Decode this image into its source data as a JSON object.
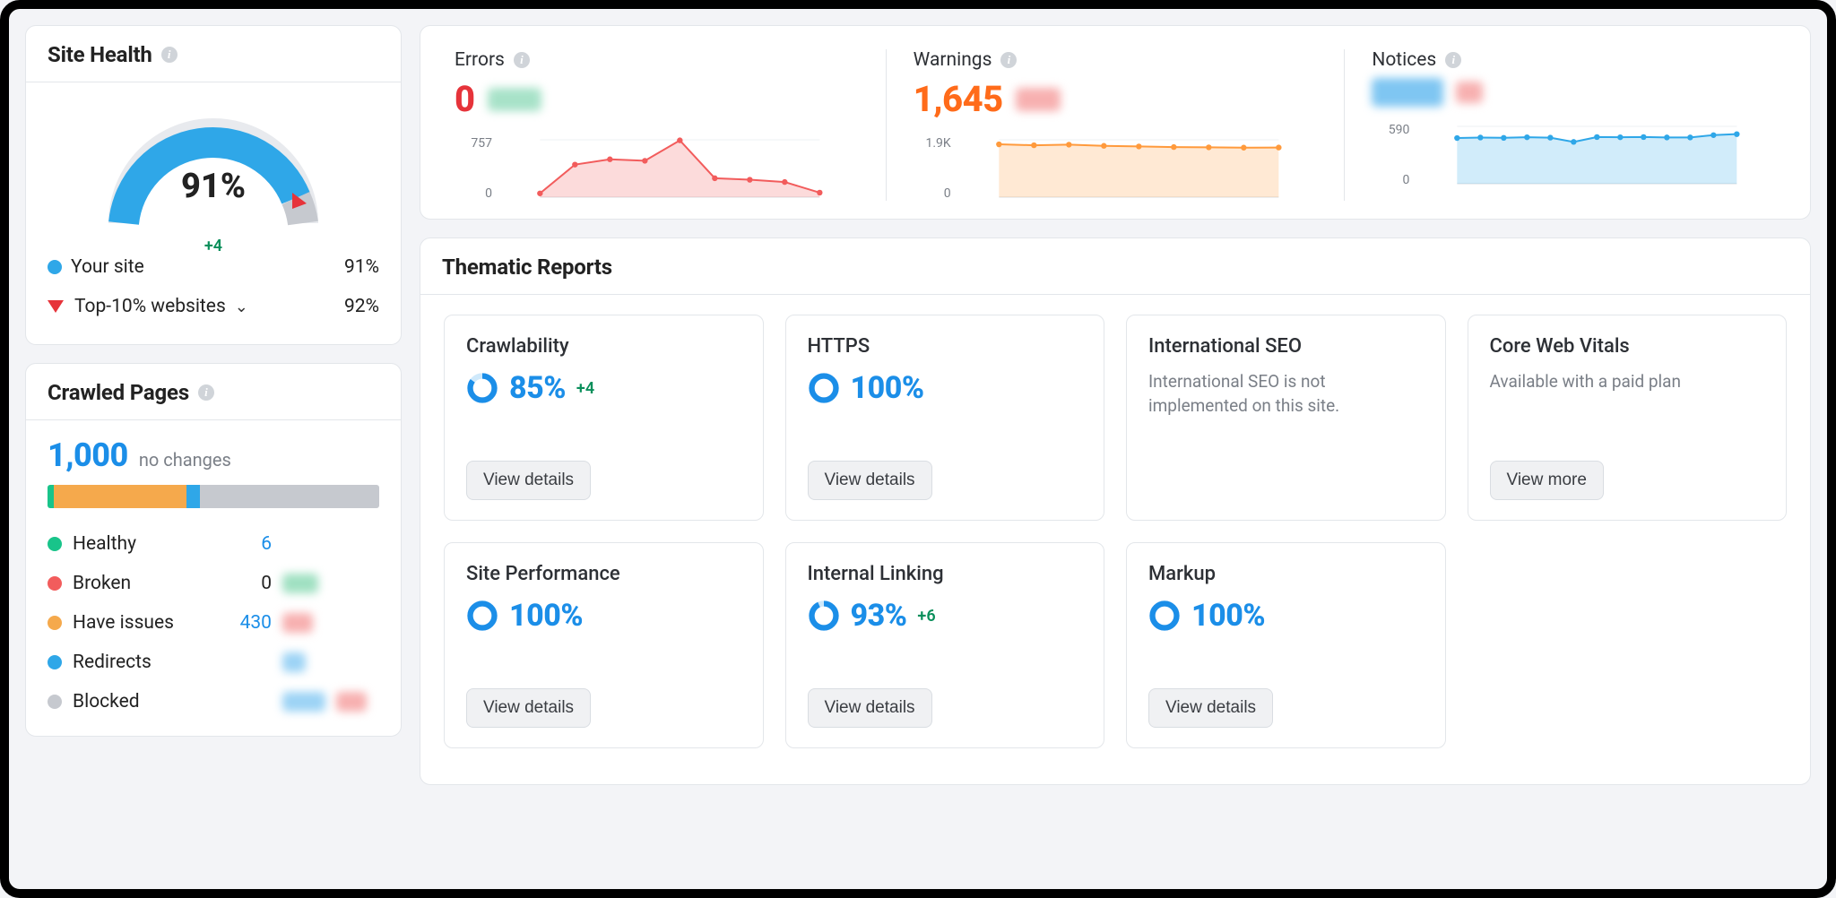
{
  "siteHealth": {
    "title": "Site Health",
    "value": "91%",
    "delta": "+4",
    "legend": {
      "yourSite": {
        "label": "Your site",
        "value": "91%"
      },
      "top10": {
        "label": "Top-10% websites",
        "value": "92%"
      }
    }
  },
  "crawledPages": {
    "title": "Crawled Pages",
    "count": "1,000",
    "changeNote": "no changes",
    "segments": {
      "green": 2,
      "orange": 40,
      "blue": 4,
      "gray": 54
    },
    "rows": {
      "healthy": {
        "label": "Healthy",
        "count": "6"
      },
      "broken": {
        "label": "Broken",
        "count": "0"
      },
      "haveIssues": {
        "label": "Have issues",
        "count": "430"
      },
      "redirects": {
        "label": "Redirects",
        "count": ""
      },
      "blocked": {
        "label": "Blocked",
        "count": ""
      }
    }
  },
  "metrics": {
    "errors": {
      "label": "Errors",
      "value": "0",
      "ymax": "757",
      "ymin": "0"
    },
    "warnings": {
      "label": "Warnings",
      "value": "1,645",
      "ymax": "1.9K",
      "ymin": "0"
    },
    "notices": {
      "label": "Notices",
      "value": "",
      "ymax": "590",
      "ymin": "0"
    }
  },
  "thematic": {
    "title": "Thematic Reports",
    "viewDetails": "View details",
    "viewMore": "View more",
    "reports": {
      "crawlability": {
        "title": "Crawlability",
        "score": "85%",
        "delta": "+4",
        "donut": 85
      },
      "https": {
        "title": "HTTPS",
        "score": "100%",
        "delta": "",
        "donut": 100
      },
      "intlSeo": {
        "title": "International SEO",
        "note": "International SEO is not implemented on this site."
      },
      "cwv": {
        "title": "Core Web Vitals",
        "note": "Available with a paid plan"
      },
      "performance": {
        "title": "Site Performance",
        "score": "100%",
        "delta": "",
        "donut": 100
      },
      "internalLinking": {
        "title": "Internal Linking",
        "score": "93%",
        "delta": "+6",
        "donut": 93
      },
      "markup": {
        "title": "Markup",
        "score": "100%",
        "delta": "",
        "donut": 100
      }
    }
  },
  "chart_data": [
    {
      "type": "line",
      "title": "Errors",
      "y": [
        50,
        430,
        500,
        480,
        750,
        250,
        230,
        200,
        60
      ],
      "ylim": [
        0,
        757
      ],
      "fill": true,
      "color": "#f25c5c"
    },
    {
      "type": "line",
      "title": "Warnings",
      "y": [
        1750,
        1720,
        1740,
        1700,
        1680,
        1660,
        1650,
        1640,
        1645
      ],
      "ylim": [
        0,
        1900
      ],
      "fill": true,
      "color": "#ff9a3c"
    },
    {
      "type": "line",
      "title": "Notices",
      "y": [
        470,
        475,
        472,
        478,
        474,
        430,
        480,
        478,
        480,
        476,
        476,
        500,
        510
      ],
      "ylim": [
        0,
        590
      ],
      "fill": true,
      "color": "#2fa7e8"
    }
  ]
}
